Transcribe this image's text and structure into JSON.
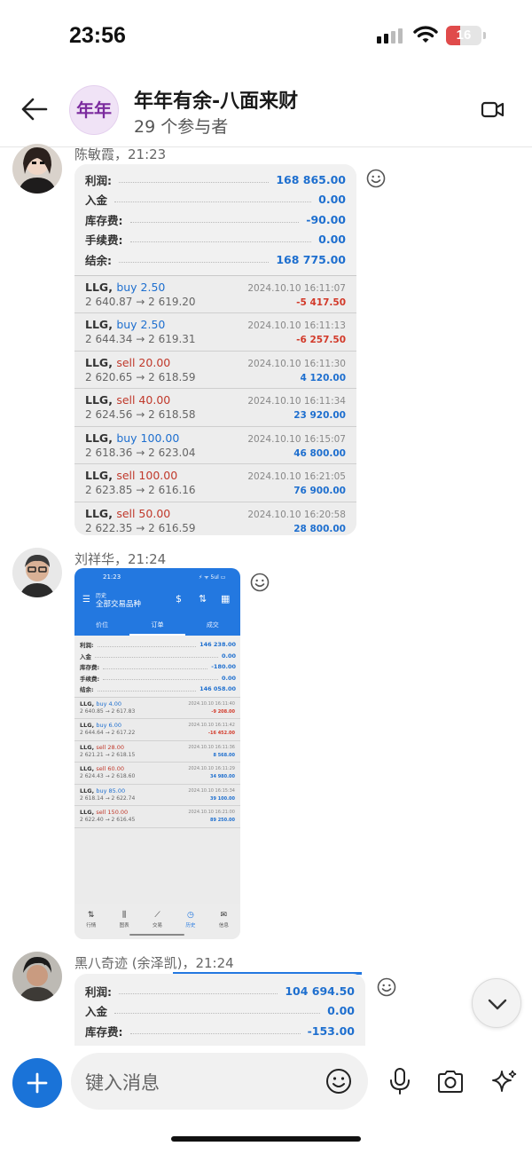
{
  "status_bar": {
    "time": "23:56",
    "battery": "16"
  },
  "header": {
    "title": "年年有余-八面来财",
    "subtitle": "29 个参与者",
    "avatar_text": "年年"
  },
  "messages": [
    {
      "sender": "陈敏霞，21:23",
      "report": {
        "summary": [
          {
            "label": "利润:",
            "value": "168 865.00"
          },
          {
            "label": "入金",
            "value": "0.00"
          },
          {
            "label": "库存费:",
            "value": "-90.00"
          },
          {
            "label": "手续费:",
            "value": "0.00"
          },
          {
            "label": "结余:",
            "value": "168 775.00"
          }
        ],
        "trades": [
          {
            "symbol": "LLG,",
            "side": "buy",
            "qty": "buy 2.50",
            "prices": "2 640.87 → 2 619.20",
            "date": "2024.10.10 16:11:07",
            "pnl": "-5 417.50"
          },
          {
            "symbol": "LLG,",
            "side": "buy",
            "qty": "buy 2.50",
            "prices": "2 644.34 → 2 619.31",
            "date": "2024.10.10 16:11:13",
            "pnl": "-6 257.50"
          },
          {
            "symbol": "LLG,",
            "side": "sell",
            "qty": "sell 20.00",
            "prices": "2 620.65 → 2 618.59",
            "date": "2024.10.10 16:11:30",
            "pnl": "4 120.00"
          },
          {
            "symbol": "LLG,",
            "side": "sell",
            "qty": "sell 40.00",
            "prices": "2 624.56 → 2 618.58",
            "date": "2024.10.10 16:11:34",
            "pnl": "23 920.00"
          },
          {
            "symbol": "LLG,",
            "side": "buy",
            "qty": "buy 100.00",
            "prices": "2 618.36 → 2 623.04",
            "date": "2024.10.10 16:15:07",
            "pnl": "46 800.00"
          },
          {
            "symbol": "LLG,",
            "side": "sell",
            "qty": "sell 100.00",
            "prices": "2 623.85 → 2 616.16",
            "date": "2024.10.10 16:21:05",
            "pnl": "76 900.00"
          },
          {
            "symbol": "LLG,",
            "side": "sell",
            "qty": "sell 50.00",
            "prices": "2 622.35 → 2 616.59",
            "date": "2024.10.10 16:20:58",
            "pnl": "28 800.00"
          }
        ]
      }
    },
    {
      "sender": "刘祥华，21:24",
      "screenshot": {
        "time": "21:23",
        "status": "⚡ ᯤ 5ul ▭",
        "sub1": "历史",
        "sub2": "全部交易品种",
        "tabs": [
          "价位",
          "订单",
          "成交"
        ],
        "summary": [
          {
            "label": "利润:",
            "value": "146 238.00"
          },
          {
            "label": "入金",
            "value": "0.00"
          },
          {
            "label": "库存费:",
            "value": "-180.00"
          },
          {
            "label": "手续费:",
            "value": "0.00"
          },
          {
            "label": "结余:",
            "value": "146 058.00"
          }
        ],
        "trades": [
          {
            "symbol": "LLG,",
            "side": "buy",
            "qty": "buy 4.00",
            "prices": "2 640.85 → 2 617.83",
            "date": "2024.10.10 16:11:40",
            "pnl": "-9 208.00"
          },
          {
            "symbol": "LLG,",
            "side": "buy",
            "qty": "buy 6.00",
            "prices": "2 644.64 → 2 617.22",
            "date": "2024.10.10 16:11:42",
            "pnl": "-16 452.00"
          },
          {
            "symbol": "LLG,",
            "side": "sell",
            "qty": "sell 28.00",
            "prices": "2 621.21 → 2 618.15",
            "date": "2024.10.10 16:11:36",
            "pnl": "8 568.00"
          },
          {
            "symbol": "LLG,",
            "side": "sell",
            "qty": "sell 60.00",
            "prices": "2 624.43 → 2 618.60",
            "date": "2024.10.10 16:11:29",
            "pnl": "34 980.00"
          },
          {
            "symbol": "LLG,",
            "side": "buy",
            "qty": "buy 85.00",
            "prices": "2 618.14 → 2 622.74",
            "date": "2024.10.10 16:15:34",
            "pnl": "39 100.00"
          },
          {
            "symbol": "LLG,",
            "side": "sell",
            "qty": "sell 150.00",
            "prices": "2 622.40 → 2 616.45",
            "date": "2024.10.10 16:21:00",
            "pnl": "89 250.00"
          }
        ],
        "nav": [
          {
            "icon": "⇅",
            "label": "行情"
          },
          {
            "icon": "⫼",
            "label": "图表"
          },
          {
            "icon": "⟋",
            "label": "交易"
          },
          {
            "icon": "◷",
            "label": "历史"
          },
          {
            "icon": "✉",
            "label": "信息"
          }
        ]
      }
    },
    {
      "sender": "黑八奇迹 (余泽凯)，21:24",
      "report": {
        "summary": [
          {
            "label": "利润:",
            "value": "104 694.50"
          },
          {
            "label": "入金",
            "value": "0.00"
          },
          {
            "label": "库存费:",
            "value": "-153.00"
          }
        ]
      }
    }
  ],
  "composer": {
    "placeholder": "键入消息"
  },
  "colors": {
    "accent": "#1a73d8",
    "profit": "#1e6fcf",
    "loss": "#d23a2a"
  }
}
